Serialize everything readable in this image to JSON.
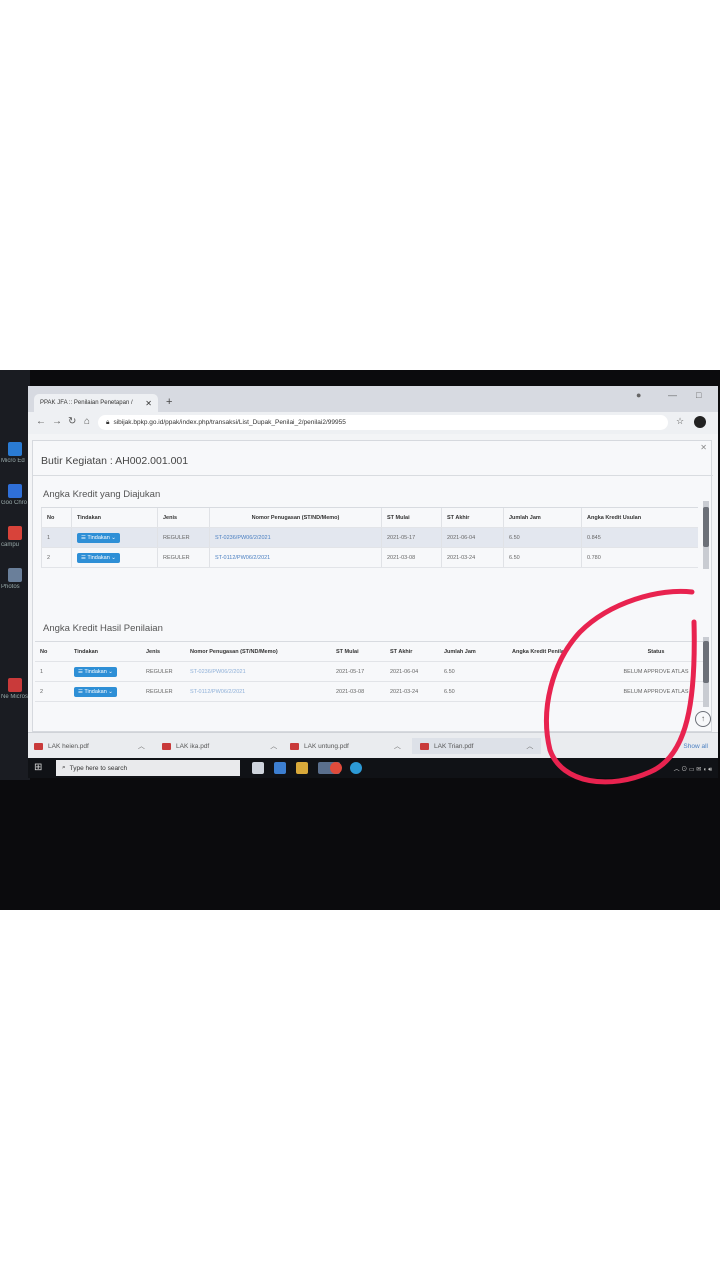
{
  "browser": {
    "tab_title": "PPAK JFA :: Penilaian Penetapan /",
    "url": "sibijak.bpkp.go.id/ppak/index.php/transaksi/List_Dupak_Penilai_2/penilai2/99955"
  },
  "modal": {
    "title": "Butir Kegiatan : AH002.001.001",
    "section1_title": "Angka Kredit yang Diajukan",
    "section2_title": "Angka Kredit Hasil Penilaian"
  },
  "table1": {
    "headers": [
      "No",
      "Tindakan",
      "Jenis",
      "Nomor Penugasan (ST/ND/Memo)",
      "ST Mulai",
      "ST Akhir",
      "Jumlah Jam",
      "Angka Kredit Usulan"
    ],
    "rows": [
      {
        "no": "1",
        "tindakan": "☰ Tindakan ⌄",
        "jenis": "REGULER",
        "nomor": "ST-0236/PW06/2/2021",
        "mulai": "2021-05-17",
        "akhir": "2021-06-04",
        "jam": "6.50",
        "angka": "0.845"
      },
      {
        "no": "2",
        "tindakan": "☰ Tindakan ⌄",
        "jenis": "REGULER",
        "nomor": "ST-0112/PW06/2/2021",
        "mulai": "2021-03-08",
        "akhir": "2021-03-24",
        "jam": "6.50",
        "angka": "0.780"
      }
    ]
  },
  "table2": {
    "headers": [
      "No",
      "Tindakan",
      "Jenis",
      "Nomor Penugasan (ST/ND/Memo)",
      "ST Mulai",
      "ST Akhir",
      "Jumlah Jam",
      "Angka Kredit Penilai",
      "Status"
    ],
    "rows": [
      {
        "no": "1",
        "tindakan": "☰ Tindakan ⌄",
        "jenis": "REGULER",
        "nomor": "ST-0236/PW06/2/2021",
        "mulai": "2021-05-17",
        "akhir": "2021-06-04",
        "jam": "6.50",
        "angka": "",
        "status": "BELUM APPROVE ATLAS"
      },
      {
        "no": "2",
        "tindakan": "☰ Tindakan ⌄",
        "jenis": "REGULER",
        "nomor": "ST-0112/PW06/2/2021",
        "mulai": "2021-03-08",
        "akhir": "2021-03-24",
        "jam": "6.50",
        "angka": "",
        "status": "BELUM APPROVE ATLAS"
      }
    ]
  },
  "downloads": {
    "items": [
      "LAK heien.pdf",
      "LAK ika.pdf",
      "LAK untung.pdf",
      "LAK Trian.pdf"
    ],
    "show_all": "Show all"
  },
  "taskbar": {
    "search_placeholder": "Type here to search"
  },
  "desktop": {
    "labels": [
      "Micro Ed",
      "Goo Chro",
      "campu",
      "Photos",
      "Ne Micros"
    ]
  },
  "colors": {
    "accent_blue": "#2e8fd6",
    "annotation_red": "#e8234f",
    "pdf_red": "#c93a3a"
  },
  "icons": [
    "back-icon",
    "forward-icon",
    "reload-icon",
    "home-icon",
    "lock-icon",
    "star-icon",
    "close-icon",
    "pdf-icon",
    "windows-start-icon",
    "search-icon",
    "chrome-icon",
    "edge-icon",
    "scroll-up-icon"
  ]
}
